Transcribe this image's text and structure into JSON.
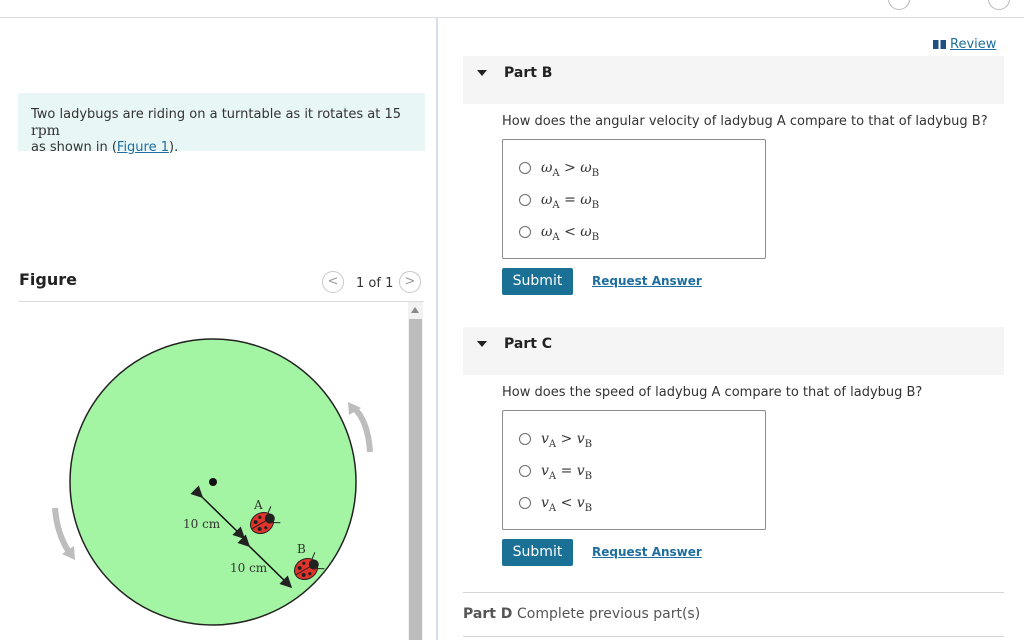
{
  "problem": {
    "text_before": "Two ladybugs are riding on a turntable as it rotates at 15 ",
    "rpm": "rpm",
    "text_mid": "as shown in (",
    "figure_link": "Figure 1",
    "text_after": ")."
  },
  "figure_panel": {
    "title": "Figure",
    "page_count": "1 of 1",
    "prev_glyph": "<",
    "next_glyph": ">",
    "labels": {
      "ladybug_a": "A",
      "ladybug_b": "B",
      "dist_1": "10 cm",
      "dist_2": "10 cm"
    },
    "colors": {
      "turntable": "#a3f5a4",
      "arrow": "#bdbdbd"
    }
  },
  "review": {
    "label": "Review"
  },
  "part_b": {
    "title": "Part B",
    "question": "How does the angular velocity of ladybug A compare to that of ladybug B?",
    "options": [
      {
        "sym": "ω",
        "sub_a": "A",
        "op": ">",
        "sub_b": "B"
      },
      {
        "sym": "ω",
        "sub_a": "A",
        "op": "=",
        "sub_b": "B"
      },
      {
        "sym": "ω",
        "sub_a": "A",
        "op": "<",
        "sub_b": "B"
      }
    ],
    "submit_label": "Submit",
    "request_label": "Request Answer"
  },
  "part_c": {
    "title": "Part C",
    "question": "How does the speed of ladybug A compare to that of ladybug B?",
    "options": [
      {
        "sym": "v",
        "sub_a": "A",
        "op": ">",
        "sub_b": "B"
      },
      {
        "sym": "v",
        "sub_a": "A",
        "op": "=",
        "sub_b": "B"
      },
      {
        "sym": "v",
        "sub_a": "A",
        "op": "<",
        "sub_b": "B"
      }
    ],
    "submit_label": "Submit",
    "request_label": "Request Answer"
  },
  "part_d": {
    "label": "Part D",
    "status": "Complete previous part(s)"
  },
  "colors": {
    "accent": "#1a7195",
    "link": "#1e6f9f",
    "problem_bg": "#e8f6f6"
  }
}
